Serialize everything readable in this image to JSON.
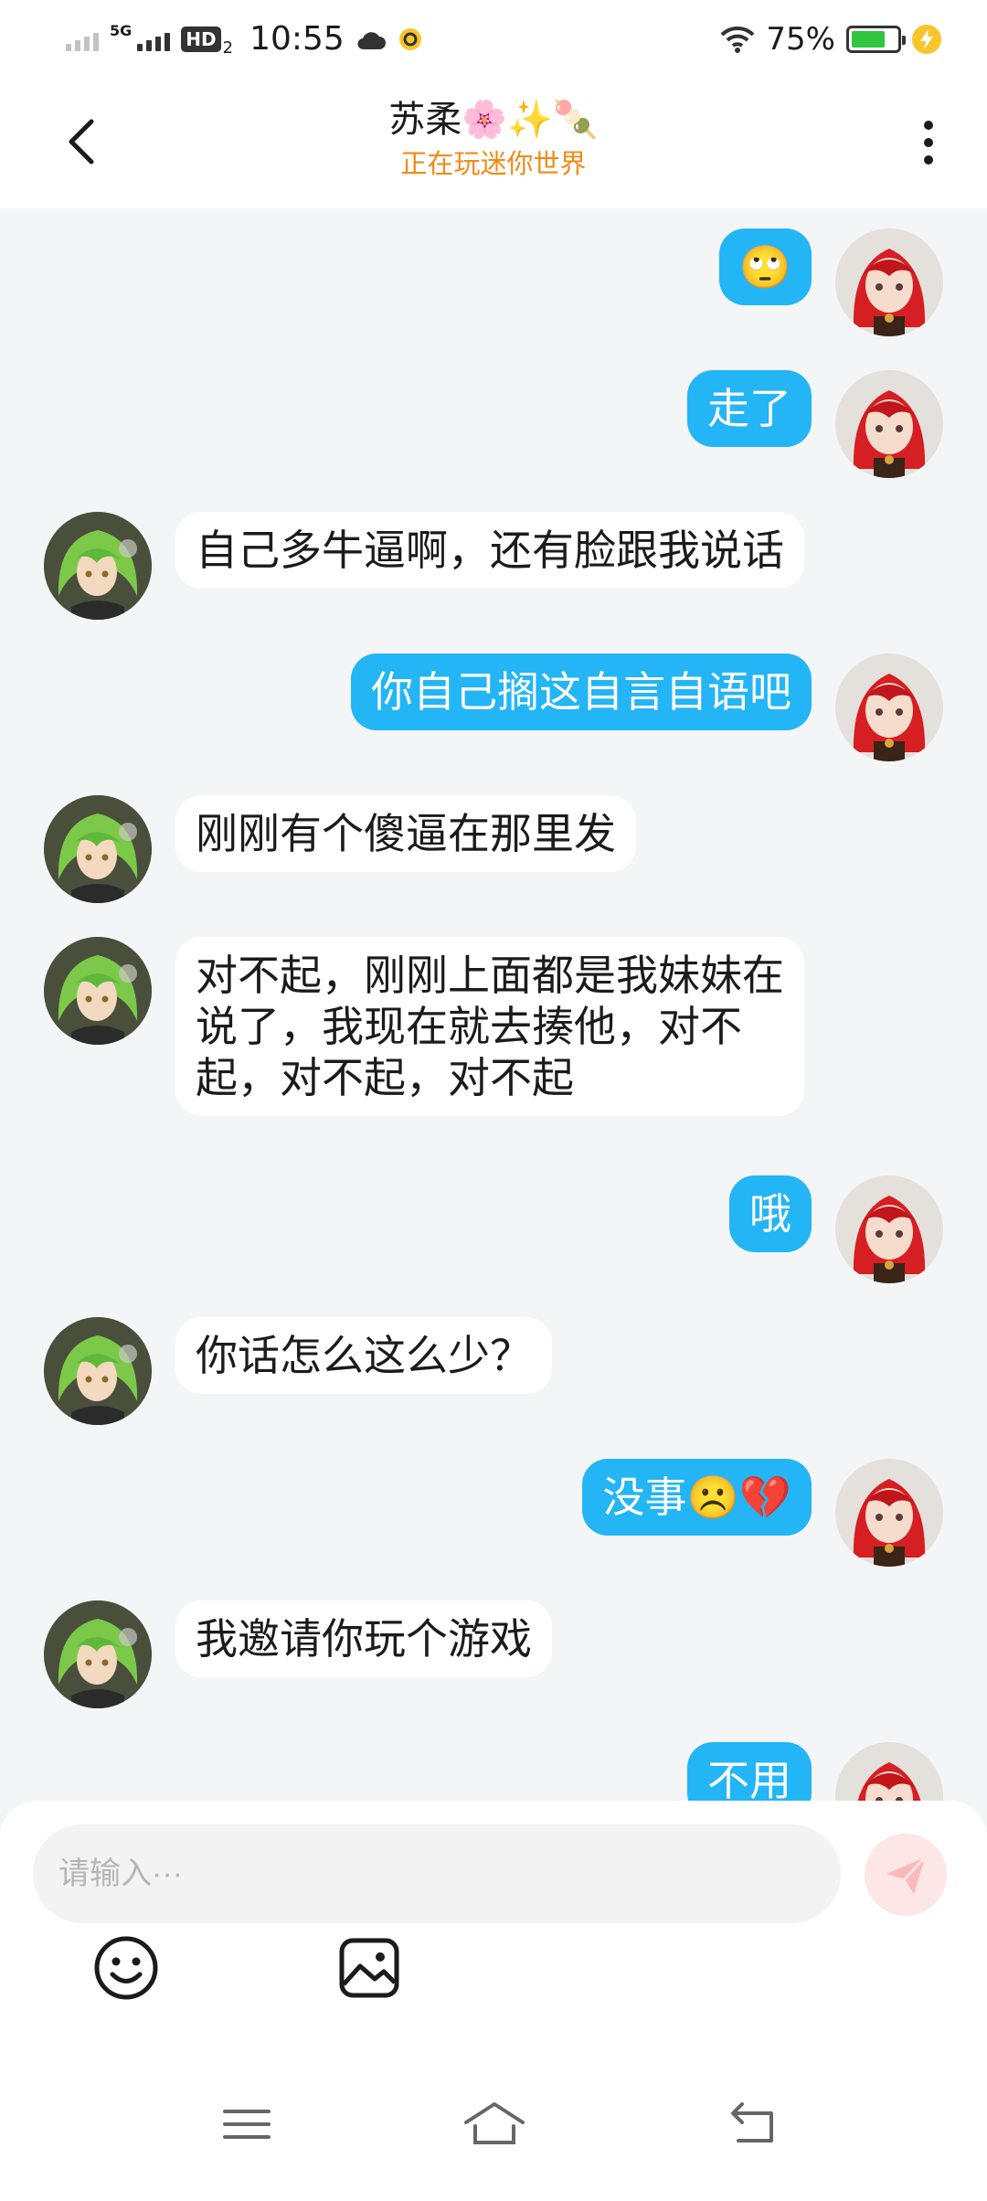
{
  "status": {
    "time": "10:55",
    "network": "5G",
    "hd": "HD",
    "hd_sub": "2",
    "battery": "75%",
    "battery_level": 0.75
  },
  "header": {
    "title": "苏柔🌸✨🍡",
    "subtitle": "正在玩迷你世界"
  },
  "messages": [
    {
      "from": "me",
      "text": "🙄"
    },
    {
      "from": "me",
      "text": "走了"
    },
    {
      "from": "other",
      "text": "自己多牛逼啊，还有脸跟我说话"
    },
    {
      "from": "me",
      "text": "你自己搁这自言自语吧"
    },
    {
      "from": "other",
      "text": "刚刚有个傻逼在那里发"
    },
    {
      "from": "other",
      "text": "对不起，刚刚上面都是我妹妹在\n说了，我现在就去揍他，对不\n起，对不起，对不起"
    },
    {
      "from": "me",
      "text": "哦"
    },
    {
      "from": "other",
      "text": "你话怎么这么少？"
    },
    {
      "from": "me",
      "text": "没事☹️💔"
    },
    {
      "from": "other",
      "text": "我邀请你玩个游戏"
    },
    {
      "from": "me",
      "text": "不用"
    }
  ],
  "input": {
    "placeholder": "请输入···"
  },
  "colors": {
    "my_bubble": "#23b5f6",
    "accent_orange": "#f08a17",
    "background": "#f4f5f7"
  },
  "icons": {
    "back": "chevron-left-icon",
    "more": "more-vertical-icon",
    "send": "send-icon",
    "emoji": "emoji-icon",
    "image": "image-icon",
    "menu": "menu-icon",
    "home": "home-icon",
    "return": "return-icon"
  }
}
